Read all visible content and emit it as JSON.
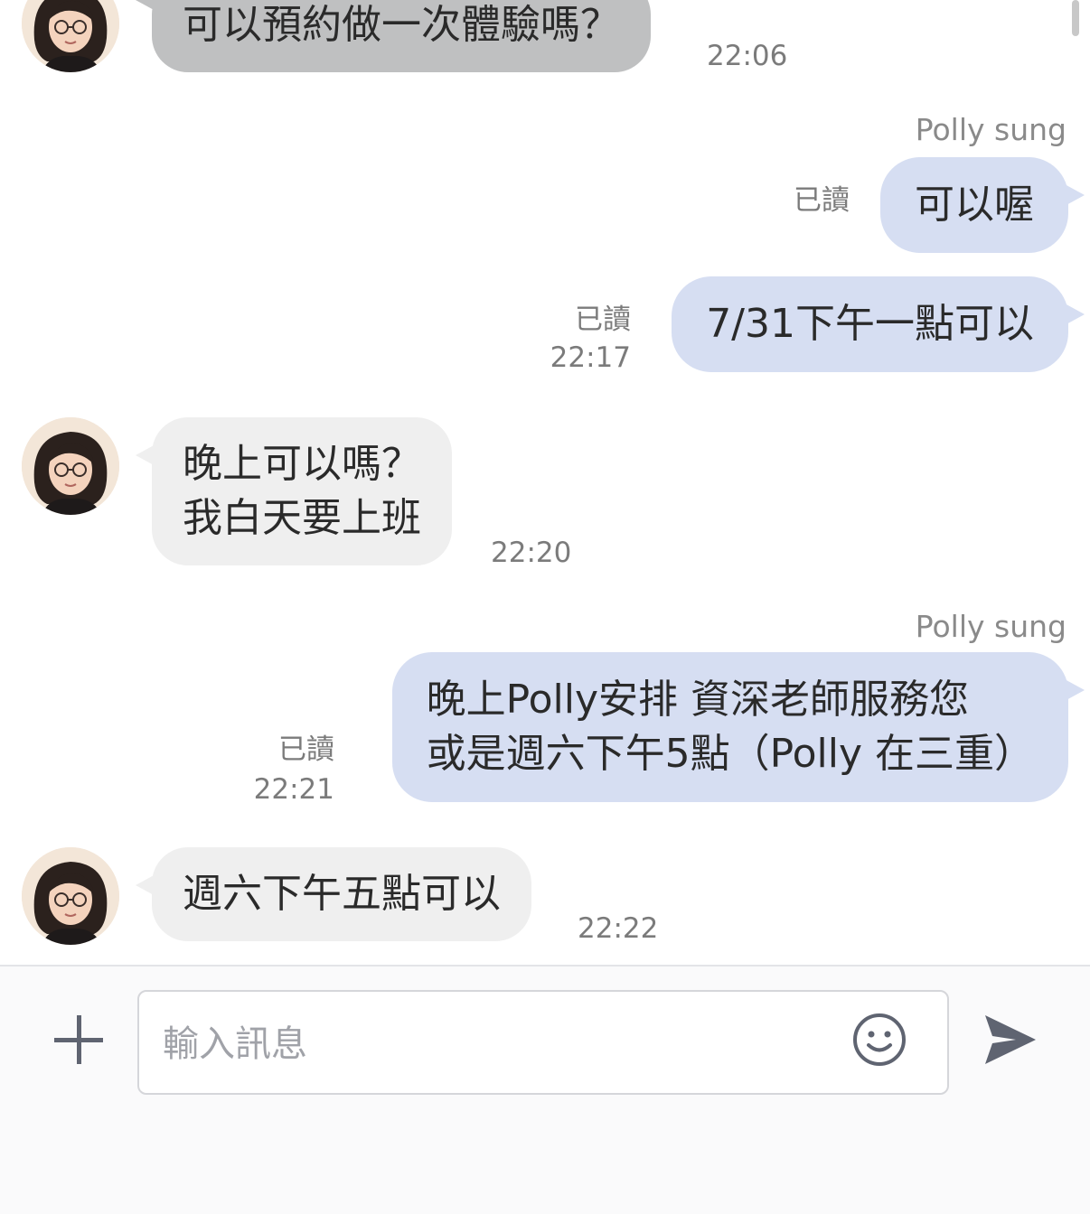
{
  "messages": [
    {
      "side": "in",
      "lines": [
        "可以預約做一次體驗嗎？"
      ],
      "time": "22:06"
    },
    {
      "side": "out",
      "sender": "Polly sung",
      "lines": [
        "可以喔"
      ],
      "read": "已讀",
      "time": ""
    },
    {
      "side": "out",
      "lines": [
        "7/31下午一點可以"
      ],
      "read": "已讀",
      "time": "22:17"
    },
    {
      "side": "in",
      "lines": [
        "晚上可以嗎？",
        "我白天要上班"
      ],
      "time": "22:20"
    },
    {
      "side": "out",
      "sender": "Polly sung",
      "lines": [
        "晚上Polly安排 資深老師服務您",
        "或是週六下午5點（Polly 在三重）"
      ],
      "read": "已讀",
      "time": "22:21"
    },
    {
      "side": "in",
      "lines": [
        "週六下午五點可以"
      ],
      "time": "22:22"
    }
  ],
  "composer": {
    "placeholder": "輸入訊息",
    "plus_icon": "plus-icon",
    "emoji_icon": "smiley-icon",
    "send_icon": "send-icon"
  },
  "colors": {
    "incoming_bubble": "#efefef",
    "incoming_bubble_first": "#bfc0c1",
    "outgoing_bubble": "#d6def2",
    "meta_text": "#7b7b7b",
    "icon": "#5f6471"
  }
}
